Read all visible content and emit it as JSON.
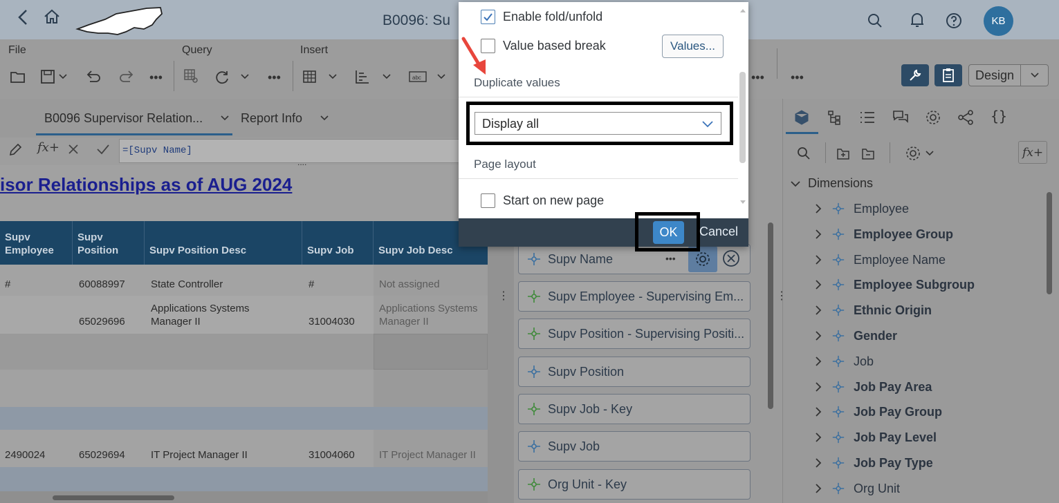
{
  "shell": {
    "title": "B0096: Su",
    "avatar_initials": "KB"
  },
  "toolbar": {
    "groups": [
      "File",
      "Query",
      "Insert"
    ],
    "design_label": "Design"
  },
  "tabs": [
    {
      "label": "B0096 Supervisor Relation..."
    },
    {
      "label": "Report Info"
    }
  ],
  "formula": {
    "value": "=[Supv Name]",
    "fx_label": "fx+",
    "ellipsis": "...."
  },
  "report": {
    "title": "isor Relationships as of AUG 2024",
    "columns": [
      "Supv Employee",
      "Supv Position",
      "Supv Position Desc",
      "Supv Job",
      "Supv Job Desc"
    ],
    "rows": [
      [
        "#",
        "60088997",
        "State Controller",
        "#",
        "Not assigned"
      ],
      [
        "",
        "65029696",
        "Applications Systems Manager II",
        "31004030",
        "Applications Systems Manager II"
      ],
      [
        "2490024",
        "65029694",
        "IT Project Manager II",
        "31004060",
        "IT Project Manager II"
      ]
    ]
  },
  "middle_panel": {
    "fields": [
      {
        "label": "Supv Name",
        "type": "attribute"
      },
      {
        "label": "Supv Employee - Supervising Em...",
        "type": "key"
      },
      {
        "label": "Supv Position - Supervising Positi...",
        "type": "key"
      },
      {
        "label": "Supv Position",
        "type": "attribute"
      },
      {
        "label": "Supv Job - Key",
        "type": "key"
      },
      {
        "label": "Supv Job",
        "type": "attribute"
      },
      {
        "label": "Org Unit - Key",
        "type": "key"
      }
    ]
  },
  "right_panel": {
    "fx_label": "fx+",
    "dimensions_header": "Dimensions",
    "dimensions": [
      {
        "label": "Employee",
        "bold": false
      },
      {
        "label": "Employee Group",
        "bold": true
      },
      {
        "label": "Employee Name",
        "bold": false
      },
      {
        "label": "Employee Subgroup",
        "bold": true
      },
      {
        "label": "Ethnic Origin",
        "bold": true
      },
      {
        "label": "Gender",
        "bold": true
      },
      {
        "label": "Job",
        "bold": false
      },
      {
        "label": "Job Pay Area",
        "bold": true
      },
      {
        "label": "Job Pay Group",
        "bold": true
      },
      {
        "label": "Job Pay Level",
        "bold": true
      },
      {
        "label": "Job Pay Type",
        "bold": true
      },
      {
        "label": "Org Unit",
        "bold": false
      }
    ]
  },
  "dialog": {
    "enable_fold_label": "Enable fold/unfold",
    "enable_fold_checked": true,
    "value_break_label": "Value based break",
    "value_break_checked": false,
    "values_button": "Values...",
    "duplicate_header": "Duplicate values",
    "duplicate_selected": "Display all",
    "page_layout_header": "Page layout",
    "new_page_label": "Start on new page",
    "new_page_checked": false,
    "ok_label": "OK",
    "cancel_label": "Cancel"
  },
  "colors": {
    "accent": "#3d87c8",
    "header_bg": "#1b4565",
    "annotation_arrow": "#e8463c",
    "highlight_frame": "#000000"
  }
}
